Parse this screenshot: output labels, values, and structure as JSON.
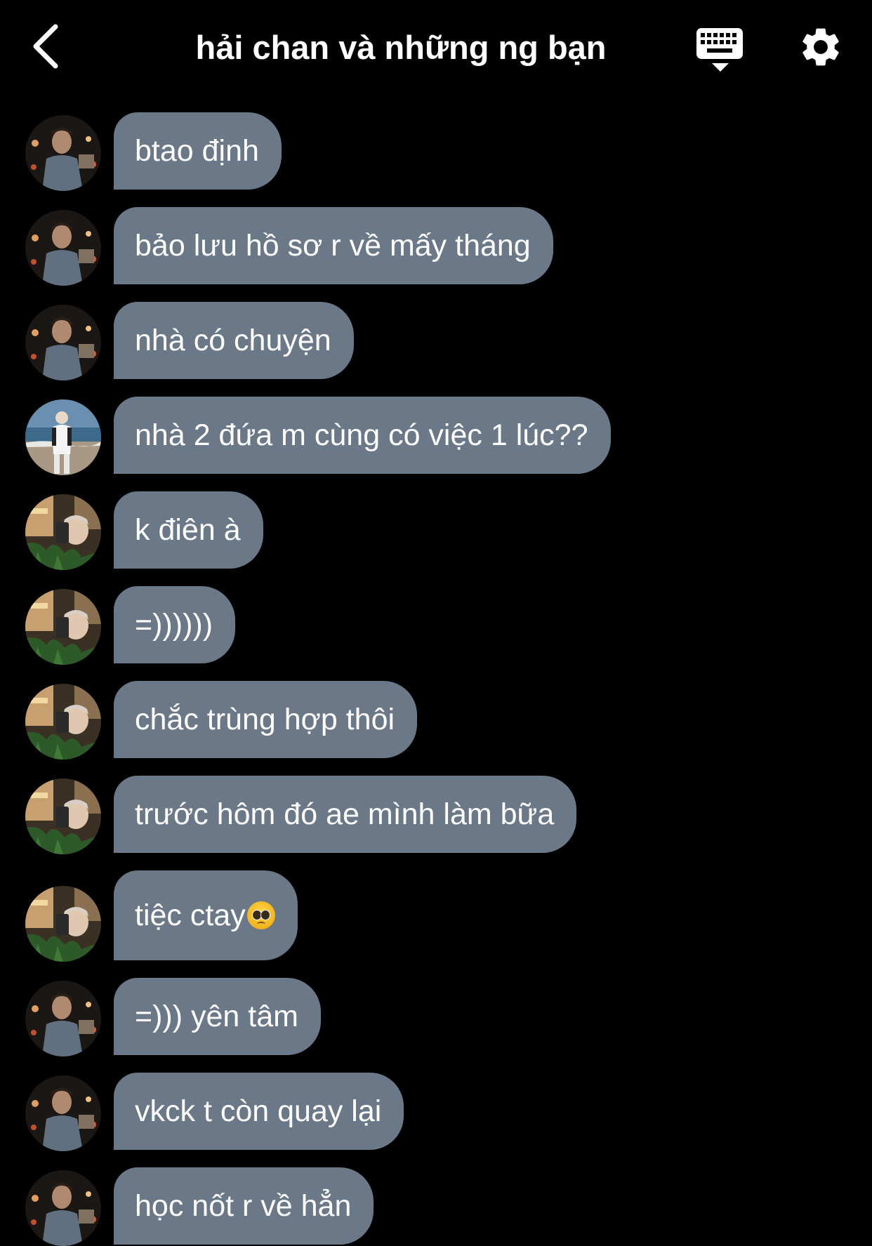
{
  "header": {
    "title": "hải chan và những ng bạn",
    "back_icon": "chevron-left-icon",
    "keyboard_icon": "keyboard-icon",
    "settings_icon": "gear-icon"
  },
  "colors": {
    "background": "#000000",
    "bubble": "#6a7887",
    "text": "#ffffff"
  },
  "messages": [
    {
      "sender": "friend-a",
      "text": "btao định"
    },
    {
      "sender": "friend-a",
      "text": "bảo lưu hồ sơ r về mấy tháng"
    },
    {
      "sender": "friend-a",
      "text": "nhà có chuyện"
    },
    {
      "sender": "friend-b",
      "text": "nhà 2 đứa m cùng có việc 1 lúc??"
    },
    {
      "sender": "friend-c",
      "text": "k điên à"
    },
    {
      "sender": "friend-c",
      "text": "=))))))"
    },
    {
      "sender": "friend-c",
      "text": "chắc trùng hợp thôi"
    },
    {
      "sender": "friend-c",
      "text": "trước hôm đó ae mình làm bữa"
    },
    {
      "sender": "friend-c",
      "text": "tiệc ctay",
      "emoji": "pleading-face-emoji"
    },
    {
      "sender": "friend-a",
      "text": "=))) yên tâm"
    },
    {
      "sender": "friend-a",
      "text": "vkck t còn quay lại"
    },
    {
      "sender": "friend-a",
      "text": "học nốt r về hẳn"
    }
  ]
}
